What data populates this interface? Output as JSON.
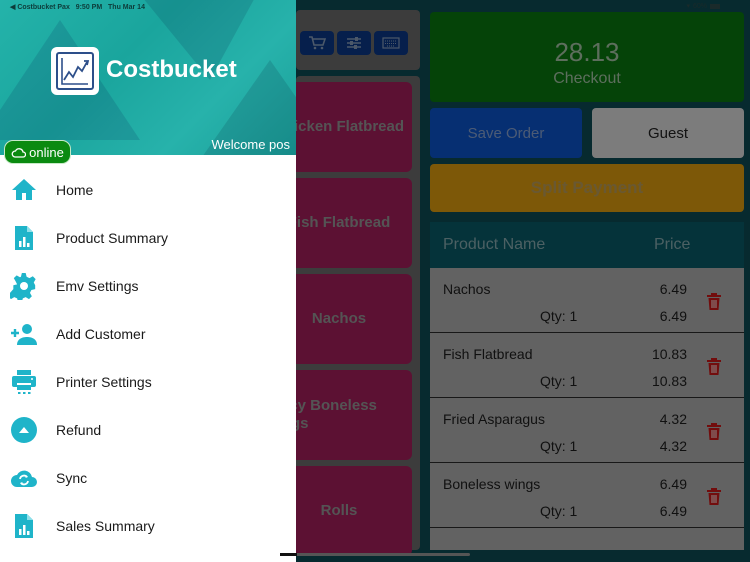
{
  "status_bar": {
    "back_app": "◀ Costbucket Pax",
    "time": "9:50 PM",
    "date": "Thu Mar 14",
    "battery": "60%"
  },
  "drawer": {
    "brand": "Costbucket",
    "welcome": "Welcome pos",
    "online_badge": "online",
    "menu": [
      {
        "label": "Home",
        "icon": "home-icon"
      },
      {
        "label": "Product Summary",
        "icon": "report-icon"
      },
      {
        "label": "Emv Settings",
        "icon": "gear-icon"
      },
      {
        "label": "Add Customer",
        "icon": "add-user-icon"
      },
      {
        "label": "Printer Settings",
        "icon": "printer-icon"
      },
      {
        "label": "Refund",
        "icon": "arrow-up-circle-icon"
      },
      {
        "label": "Sync",
        "icon": "cloud-sync-icon"
      },
      {
        "label": "Sales Summary",
        "icon": "report-icon"
      }
    ],
    "accent_color": "#1fb4c9",
    "header_color": "#1fa89f"
  },
  "toolbar": {
    "buttons": [
      {
        "icon": "cart-icon"
      },
      {
        "icon": "sliders-icon"
      },
      {
        "icon": "keyboard-icon"
      }
    ]
  },
  "products": [
    {
      "label": "Chicken Flatbread"
    },
    {
      "label": "Fish Flatbread"
    },
    {
      "label": "Nachos"
    },
    {
      "label": "Spicy Boneless wings"
    },
    {
      "label": "Rolls"
    }
  ],
  "checkout": {
    "total": "28.13",
    "label": "Checkout"
  },
  "actions": {
    "save_order": "Save Order",
    "guest": "Guest",
    "split_payment": "Split Payment"
  },
  "order": {
    "headers": {
      "name": "Product Name",
      "price": "Price"
    },
    "rows": [
      {
        "name": "Nachos",
        "price": "6.49",
        "qty": "Qty: 1",
        "ext": "6.49"
      },
      {
        "name": "Fish Flatbread",
        "price": "10.83",
        "qty": "Qty: 1",
        "ext": "10.83"
      },
      {
        "name": "Fried Asparagus",
        "price": "4.32",
        "qty": "Qty: 1",
        "ext": "4.32"
      },
      {
        "name": "Boneless wings",
        "price": "6.49",
        "qty": "Qty: 1",
        "ext": "6.49"
      }
    ]
  }
}
